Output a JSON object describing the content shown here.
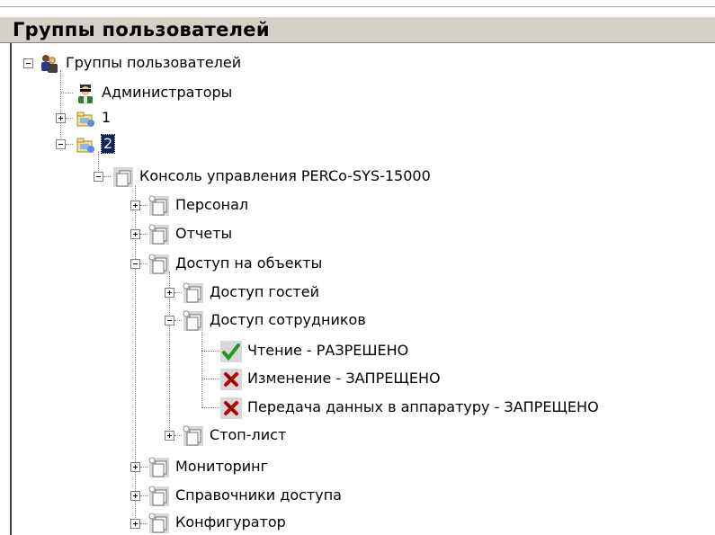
{
  "panel": {
    "title": "Группы пользователей"
  },
  "tree": {
    "root": {
      "label": "Группы пользователей",
      "icon": "user-groups-icon"
    },
    "admins": {
      "label": "Администраторы",
      "icon": "admin-user-icon"
    },
    "group1": {
      "label": "1",
      "icon": "user-group-folder-icon"
    },
    "group2": {
      "label": "2",
      "icon": "user-group-folder-icon",
      "selected": true
    },
    "console": {
      "label": "Консоль управления PERCo-SYS-15000",
      "icon": "window-stack-icon"
    },
    "personnel": {
      "label": "Персонал",
      "icon": "window-stack-icon"
    },
    "reports": {
      "label": "Отчеты",
      "icon": "window-stack-icon"
    },
    "access_objects": {
      "label": "Доступ на объекты",
      "icon": "window-stack-icon"
    },
    "guest_access": {
      "label": "Доступ гостей",
      "icon": "window-stack-icon"
    },
    "staff_access": {
      "label": "Доступ сотрудников",
      "icon": "window-stack-icon"
    },
    "read": {
      "label": "Чтение  -  РАЗРЕШЕНО",
      "icon": "check-icon"
    },
    "modify": {
      "label": "Изменение  -  ЗАПРЕЩЕНО",
      "icon": "cross-icon"
    },
    "transfer": {
      "label": "Передача данных в аппаратуру  -  ЗАПРЕЩЕНО",
      "icon": "cross-icon"
    },
    "stoplist": {
      "label": "Стоп-лист",
      "icon": "window-stack-icon"
    },
    "monitoring": {
      "label": "Мониторинг",
      "icon": "window-stack-icon"
    },
    "access_refs": {
      "label": "Справочники доступа",
      "icon": "window-stack-icon"
    },
    "configurator": {
      "label": "Конфигуратор",
      "icon": "window-stack-icon"
    }
  },
  "colors": {
    "header_bg": "#d4d0c8",
    "selection_bg": "#0a246a",
    "allowed": "#1e9a1e",
    "denied": "#c00000"
  }
}
